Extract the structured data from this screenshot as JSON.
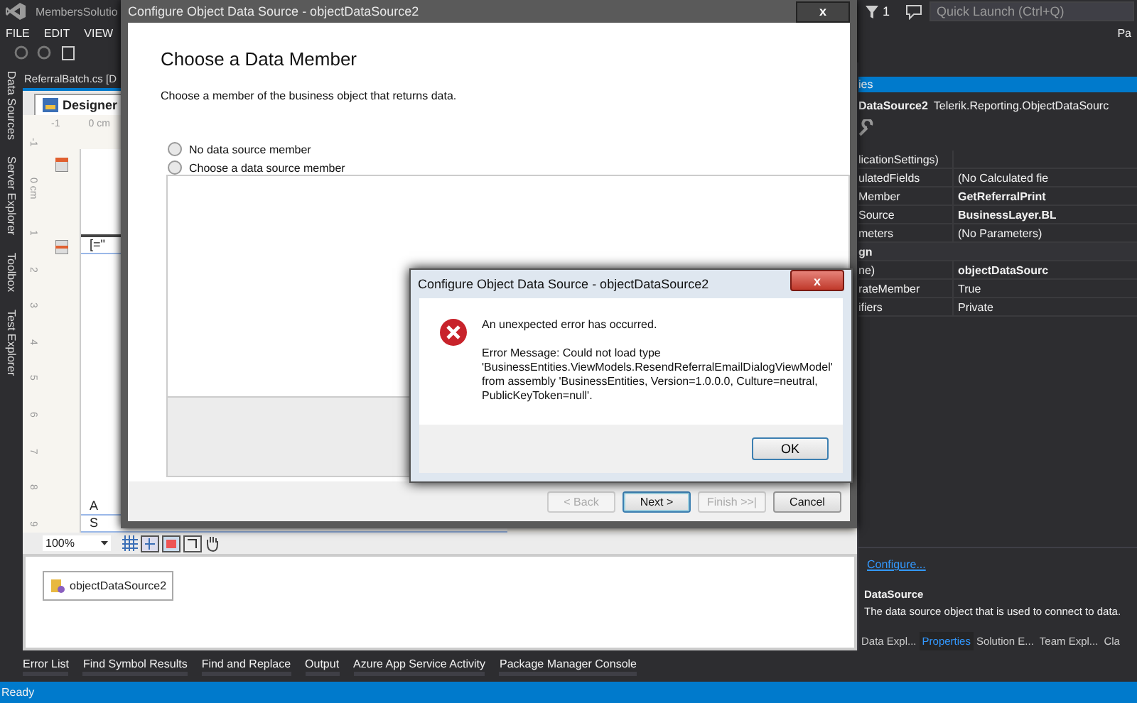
{
  "ide": {
    "title": "MembersSolutio",
    "menu": [
      "FILE",
      "EDIT",
      "VIEW"
    ],
    "notifications": "1",
    "quick_launch": {
      "placeholder": "Quick Launch (Ctrl+Q)"
    },
    "account": "Pa"
  },
  "left_tabs": [
    "Data Sources",
    "Server Explorer",
    "Toolbox",
    "Test Explorer"
  ],
  "document_tab": "ReferralBatch.cs [D",
  "designer_tab": "Designer",
  "ruler": {
    "horizontal": [
      "-1",
      "0 cm"
    ],
    "vertical": [
      "-1",
      "0 cm",
      "1",
      "2",
      "3",
      "4",
      "5",
      "6",
      "7",
      "8",
      "9"
    ]
  },
  "report_cells": [
    "[=\"",
    "A",
    "S"
  ],
  "zoom": "100%",
  "component_tray": [
    "objectDataSource2"
  ],
  "bottom_tabs": [
    "Error List",
    "Find Symbol Results",
    "Find and Replace",
    "Output",
    "Azure App Service Activity",
    "Package Manager Console"
  ],
  "status": "Ready",
  "properties": {
    "header": "ies",
    "object": "DataSource2",
    "type": "Telerik.Reporting.ObjectDataSourc",
    "rows": [
      {
        "kind": "property",
        "name": "licationSettings)"
      },
      {
        "kind": "property",
        "name": "ulatedFields",
        "value": "(No Calculated fie",
        "bold": false
      },
      {
        "kind": "property",
        "name": "Member",
        "value": "GetReferralPrint",
        "bold": true
      },
      {
        "kind": "property",
        "name": "Source",
        "value": "BusinessLayer.BL",
        "bold": true
      },
      {
        "kind": "property",
        "name": "meters",
        "value": "(No Parameters)",
        "bold": false
      },
      {
        "kind": "category",
        "name": "gn"
      },
      {
        "kind": "property",
        "name": "ne)",
        "value": "objectDataSourc",
        "bold": true
      },
      {
        "kind": "property",
        "name": "rateMember",
        "value": "True",
        "bold": false
      },
      {
        "kind": "property",
        "name": "ifiers",
        "value": "Private",
        "bold": false
      }
    ],
    "link": "Configure...",
    "help_title": "DataSource",
    "help_text": "The data source object that is used to connect to data.",
    "tabs": [
      {
        "label": "Data Expl...",
        "selected": false
      },
      {
        "label": "Properties",
        "selected": true
      },
      {
        "label": "Solution E...",
        "selected": false
      },
      {
        "label": "Team Expl...",
        "selected": false
      },
      {
        "label": "Cla",
        "selected": false
      }
    ]
  },
  "wizard": {
    "title": "Configure Object Data Source - objectDataSource2",
    "close": "x",
    "heading": "Choose a Data Member",
    "subtitle": "Choose a member of the business object that returns data.",
    "options": [
      {
        "label": "No data source member",
        "selected": false
      },
      {
        "label": "Choose a data source member",
        "selected": false
      }
    ],
    "buttons": [
      {
        "label": "< Back",
        "disabled": true,
        "default": false
      },
      {
        "label": "Next >",
        "disabled": false,
        "default": true
      },
      {
        "label": "Finish >>|",
        "disabled": true,
        "default": false
      },
      {
        "label": "Cancel",
        "disabled": false,
        "default": false
      }
    ]
  },
  "error_dialog": {
    "title": "Configure Object Data Source - objectDataSource2",
    "close": "x",
    "headline": "An unexpected error has occurred.",
    "message": "Error Message: Could not load type 'BusinessEntities.ViewModels.ResendReferralEmailDialogViewModel' from assembly 'BusinessEntities, Version=1.0.0.0, Culture=neutral, PublicKeyToken=null'.",
    "button": "OK"
  }
}
